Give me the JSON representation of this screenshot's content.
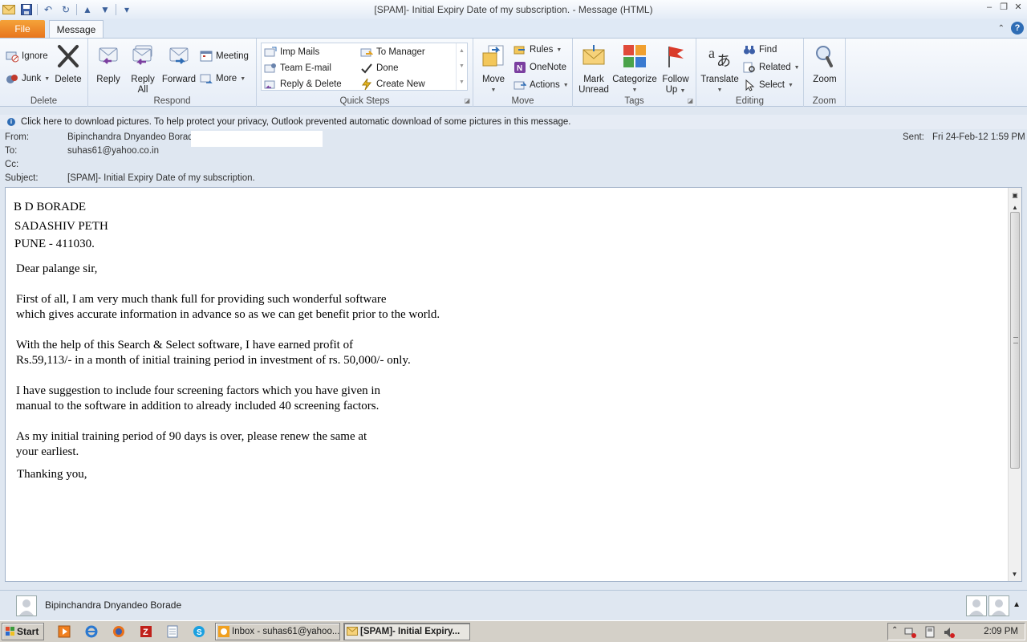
{
  "window": {
    "title": "[SPAM]- Initial Expiry Date of my subscription.  -  Message (HTML)"
  },
  "tabs": {
    "file": "File",
    "message": "Message"
  },
  "ribbon": {
    "delete": {
      "label": "Delete",
      "ignore": "Ignore",
      "junk": "Junk",
      "delete": "Delete"
    },
    "respond": {
      "label": "Respond",
      "reply": "Reply",
      "reply_all_1": "Reply",
      "reply_all_2": "All",
      "forward": "Forward",
      "meeting": "Meeting",
      "more": "More"
    },
    "quick_steps": {
      "label": "Quick Steps",
      "items": [
        "Imp Mails",
        "To Manager",
        "Team E-mail",
        "Done",
        "Reply & Delete",
        "Create New"
      ]
    },
    "move": {
      "label": "Move",
      "move": "Move",
      "rules": "Rules",
      "onenote": "OneNote",
      "actions": "Actions"
    },
    "tags": {
      "label": "Tags",
      "mark_1": "Mark",
      "mark_2": "Unread",
      "categorize": "Categorize",
      "follow_1": "Follow",
      "follow_2": "Up"
    },
    "editing": {
      "label": "Editing",
      "translate": "Translate",
      "find": "Find",
      "related": "Related",
      "select": "Select"
    },
    "zoom": {
      "label": "Zoom",
      "zoom": "Zoom"
    }
  },
  "infobar": {
    "text": "Click here to download pictures. To help protect your privacy, Outlook prevented automatic download of some pictures in this message."
  },
  "header": {
    "from_label": "From:",
    "from": "Bipinchandra Dnyandeo Borade",
    "to_label": "To:",
    "to": "suhas61@yahoo.co.in",
    "cc_label": "Cc:",
    "subject_label": "Subject:",
    "subject": "[SPAM]- Initial Expiry Date of my subscription.",
    "sent_label": "Sent:",
    "sent": "Fri 24-Feb-12 1:59 PM"
  },
  "body": {
    "addr1": "B D BORADE",
    "addr2": "SADASHIV PETH",
    "addr3": "PUNE - 411030.",
    "greeting": "Dear palange sir,",
    "p1a": "First of all, I am very much thank full for providing such wonderful software",
    "p1b": "which gives accurate information in advance so as we can get benefit prior to the world.",
    "p2a": "With the help of this Search & Select software, I have earned profit of",
    "p2b": "Rs.59,113/- in a month of initial training period in investment of rs. 50,000/- only.",
    "p3a": "I have suggestion to include four screening factors which you have given in",
    "p3b": "manual to the software in addition to already included 40 screening factors.",
    "p4a": "As my initial training period of 90 days is over, please renew the same at",
    "p4b": "your earliest.",
    "closing": "Thanking you,"
  },
  "people_pane": {
    "name": "Bipinchandra Dnyandeo Borade"
  },
  "taskbar": {
    "start": "Start",
    "task1": "Inbox - suhas61@yahoo....",
    "task2": "[SPAM]- Initial Expiry...",
    "clock": "2:09 PM"
  }
}
